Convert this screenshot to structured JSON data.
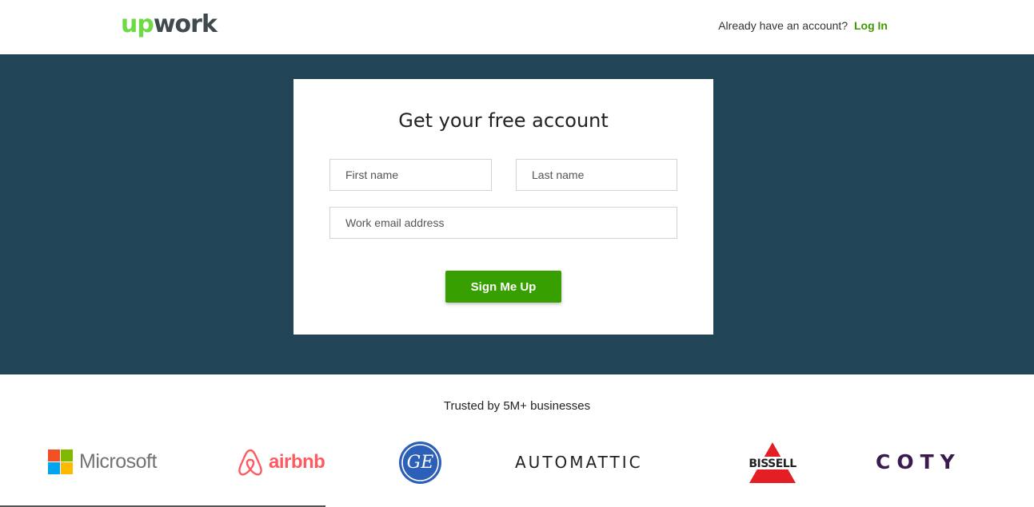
{
  "header": {
    "logo_up": "up",
    "logo_work": "work",
    "account_prompt": "Already have an account?",
    "login_link": "Log In"
  },
  "signup": {
    "title": "Get your free account",
    "first_name_placeholder": "First name",
    "last_name_placeholder": "Last name",
    "email_placeholder": "Work email address",
    "submit_label": "Sign Me Up"
  },
  "trusted": {
    "heading": "Trusted by 5M+ businesses",
    "logos": {
      "microsoft": "Microsoft",
      "airbnb": "airbnb",
      "ge": "GE",
      "automattic": "AUTOMATTIC",
      "bissell": "BISSELL",
      "coty": "COTY"
    }
  },
  "colors": {
    "brand_green": "#6fda44",
    "button_green": "#37a000",
    "link_green": "#3d9b00",
    "hero_bg": "#214456",
    "airbnb": "#ff5a5f",
    "ge_blue": "#2c5fb8",
    "bissell_red": "#e31e24",
    "coty_purple": "#3b1a4e"
  },
  "icons": [
    "upwork-logo",
    "microsoft-logo-icon",
    "airbnb-logo-icon",
    "ge-logo-icon",
    "bissell-logo-icon"
  ]
}
